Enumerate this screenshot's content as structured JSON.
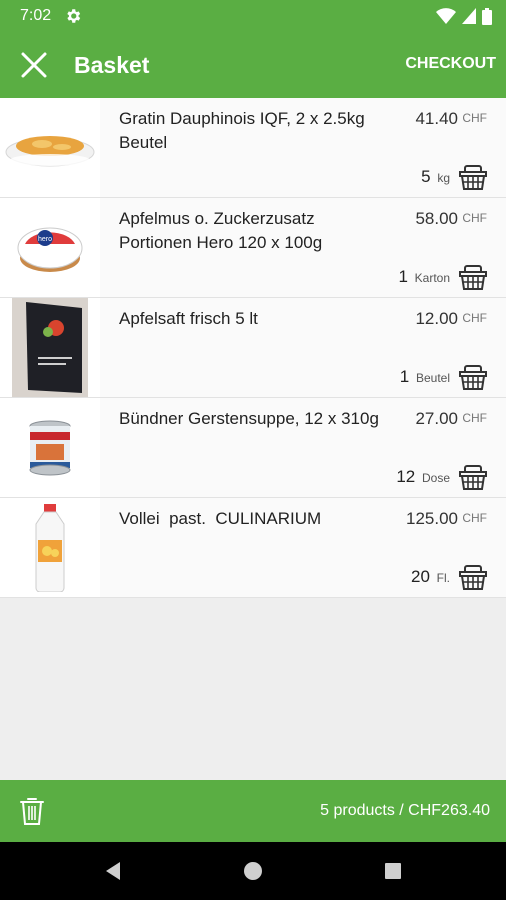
{
  "status_bar": {
    "time": "7:02"
  },
  "app_bar": {
    "title": "Basket",
    "checkout_label": "CHECKOUT"
  },
  "items": [
    {
      "name": "Gratin Dauphinois IQF, 2 x 2.5kg Beutel",
      "price": "41.40",
      "currency": "CHF",
      "qty": "5",
      "unit": "kg",
      "image": "gratin-dish-image"
    },
    {
      "name": "Apfelmus o. Zuckerzusatz Portionen Hero 120 x 100g",
      "price": "58.00",
      "currency": "CHF",
      "qty": "1",
      "unit": "Karton",
      "image": "applesauce-cup-image"
    },
    {
      "name": "Apfelsaft frisch 5 lt",
      "price": "12.00",
      "currency": "CHF",
      "qty": "1",
      "unit": "Beutel",
      "image": "apple-juice-box-image"
    },
    {
      "name": "Bündner Gerstensuppe, 12 x 310g",
      "price": "27.00",
      "currency": "CHF",
      "qty": "12",
      "unit": "Dose",
      "image": "soup-can-image"
    },
    {
      "name": "Vollei  past.  CULINARIUM",
      "price": "125.00",
      "currency": "CHF",
      "qty": "20",
      "unit": "Fl.",
      "image": "egg-bottle-image"
    }
  ],
  "footer": {
    "summary": "5 products / CHF263.40"
  },
  "colors": {
    "primary": "#5aae43",
    "background": "#eeeeee"
  }
}
